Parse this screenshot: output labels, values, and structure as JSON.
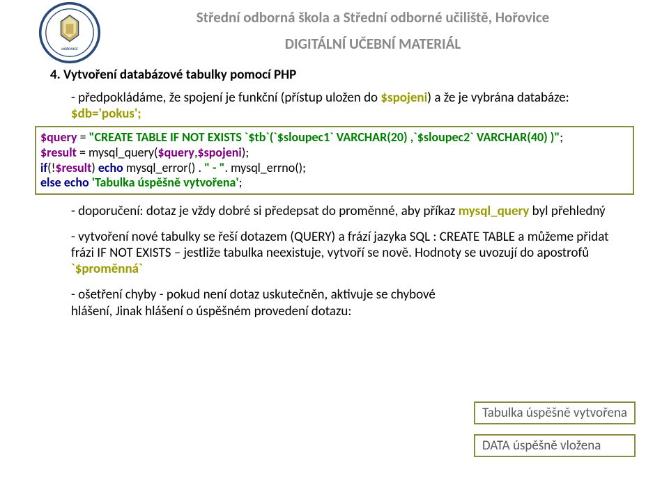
{
  "header": {
    "school_name": "Střední odborná škola a Střední odborné učiliště, Hořovice",
    "subtitle": "DIGITÁLNÍ UČEBNÍ MATERIÁL"
  },
  "section": {
    "title": "4. Vytvoření databázové tabulky pomocí PHP"
  },
  "p1": {
    "t1": "- předpokládáme, že spojení je funkční (přístup uložen do ",
    "h1": "$spojeni",
    "t2": ") a že je vybrána databáze: ",
    "h2": "$db='pokus';"
  },
  "code": {
    "l1a": "$query",
    "l1b": " = ",
    "l1c": "\"CREATE TABLE IF NOT EXISTS `$tb`(`$sloupec1` VARCHAR(20) ,`$sloupec2` VARCHAR(40) )\"",
    "l1d": ";",
    "l2a": "$result",
    "l2b": " = mysql_query(",
    "l2c": "$query",
    "l2d": ",",
    "l2e": "$spojeni",
    "l2f": ");",
    "l3a": "if",
    "l3b": "(!",
    "l3c": "$result",
    "l3d": ") ",
    "l3e": "echo ",
    "l3f": " mysql_error() . ",
    "l3g": "\" - \"",
    "l3h": ". mysql_errno();",
    "l4a": "else echo ",
    "l4b": "'Tabulka úspěšně vytvořena'",
    "l4c": ";"
  },
  "p2": {
    "t1": "- doporučení: dotaz je vždy dobré si předepsat do proměnné, aby příkaz ",
    "h1": "mysql_query",
    "t2": " byl  přehledný"
  },
  "p3": {
    "t1": "-  vytvoření nové tabulky se řeší dotazem (QUERY) a frází jazyka SQL : CREATE TABLE a můžeme přidat frázi IF NOT EXISTS – jestliže tabulka neexistuje, vytvoří se nově. Hodnoty se uvozují do apostrofů ",
    "h1": "`$proměnná`"
  },
  "p4": {
    "t1": "- ošetření chyby - pokud není dotaz uskutečněn, aktivuje se chybové hlášení, Jinak hlášení o úspěšném provedení dotazu:"
  },
  "results": {
    "r1": "Tabulka úspěšně vytvořena",
    "r2": "DATA úspěšně vložena"
  }
}
